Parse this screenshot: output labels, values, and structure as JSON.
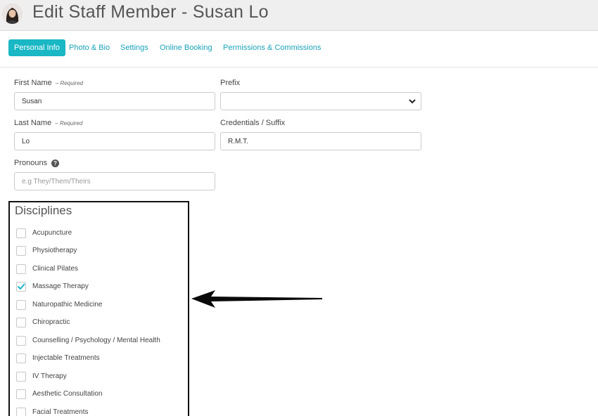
{
  "header": {
    "title": "Edit Staff Member - Susan Lo"
  },
  "tabs": [
    {
      "label": "Personal Info",
      "active": true
    },
    {
      "label": "Photo & Bio",
      "active": false
    },
    {
      "label": "Settings",
      "active": false
    },
    {
      "label": "Online Booking",
      "active": false
    },
    {
      "label": "Permissions & Commissions",
      "active": false
    }
  ],
  "form": {
    "first_name": {
      "label": "First Name",
      "required": "– Required",
      "value": "Susan"
    },
    "prefix": {
      "label": "Prefix",
      "value": ""
    },
    "last_name": {
      "label": "Last Name",
      "required": "– Required",
      "value": "Lo"
    },
    "credentials": {
      "label": "Credentials / Suffix",
      "value": "R.M.T."
    },
    "pronouns": {
      "label": "Pronouns",
      "help": "?",
      "placeholder": "e.g They/Them/Theirs",
      "value": ""
    }
  },
  "disciplines": {
    "title": "Disciplines",
    "items": [
      {
        "label": "Acupuncture",
        "checked": false
      },
      {
        "label": "Physiotherapy",
        "checked": false
      },
      {
        "label": "Clinical Pilates",
        "checked": false
      },
      {
        "label": "Massage Therapy",
        "checked": true
      },
      {
        "label": "Naturopathic Medicine",
        "checked": false
      },
      {
        "label": "Chiropractic",
        "checked": false
      },
      {
        "label": "Counselling / Psychology / Mental Health",
        "checked": false
      },
      {
        "label": "Injectable Treatments",
        "checked": false
      },
      {
        "label": "IV Therapy",
        "checked": false
      },
      {
        "label": "Aesthetic Consultation",
        "checked": false
      },
      {
        "label": "Facial Treatments",
        "checked": false
      }
    ]
  },
  "colors": {
    "accent": "#1ab7c4",
    "link": "#1aa3b8",
    "check": "#1ab7c4"
  }
}
